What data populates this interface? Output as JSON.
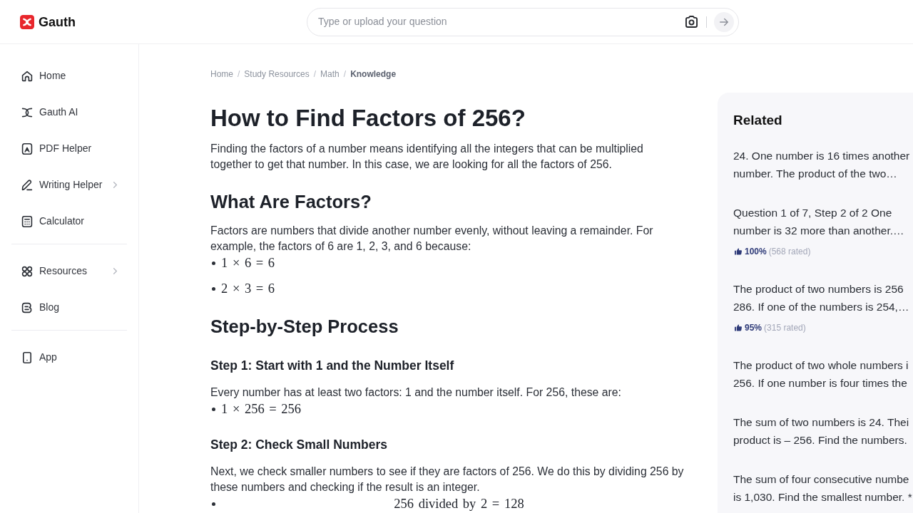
{
  "header": {
    "logo": {
      "text": "Gauth"
    },
    "search": {
      "placeholder": "Type or upload your question"
    }
  },
  "sidebar": {
    "sections": [
      {
        "items": [
          {
            "label": "Home",
            "submenu": false
          },
          {
            "label": "Gauth AI",
            "submenu": false
          },
          {
            "label": "PDF Helper",
            "submenu": false
          },
          {
            "label": "Writing Helper",
            "submenu": true
          },
          {
            "label": "Calculator",
            "submenu": false
          }
        ]
      },
      {
        "items": [
          {
            "label": "Resources",
            "submenu": true
          },
          {
            "label": "Blog",
            "submenu": false
          }
        ]
      },
      {
        "items": [
          {
            "label": "App",
            "submenu": false
          }
        ]
      }
    ]
  },
  "breadcrumb": {
    "separator": "/",
    "items": [
      {
        "label": "Home",
        "current": false
      },
      {
        "label": "Study Resources",
        "current": false
      },
      {
        "label": "Math",
        "current": false
      },
      {
        "label": "Knowledge",
        "current": true
      }
    ]
  },
  "article": {
    "title": "How to Find Factors of 256?",
    "blocks": [
      {
        "kind": "paragraph",
        "text": "Finding the factors of a number means identifying all the integers that can be multiplied together to get that number. In this case, we are looking for all the factors of 256."
      },
      {
        "kind": "heading",
        "text": "What Are Factors?"
      },
      {
        "kind": "paragraph",
        "text": "Factors are numbers that divide another number evenly, without leaving a remainder. For example, the factors of 6 are 1, 2, 3, and 6 because:"
      },
      {
        "kind": "math_list",
        "items": [
          {
            "kind": "inline",
            "text": "1 × 6 = 6"
          },
          {
            "kind": "inline",
            "text": "2 × 3 = 6"
          }
        ]
      },
      {
        "kind": "heading",
        "text": "Step-by-Step Process"
      },
      {
        "kind": "subheading",
        "text": "Step 1: Start with 1 and the Number Itself"
      },
      {
        "kind": "paragraph",
        "text": "Every number has at least two factors: 1 and the number itself. For 256, these are:"
      },
      {
        "kind": "math_list",
        "items": [
          {
            "kind": "inline",
            "text": "1 × 256 = 256"
          }
        ]
      },
      {
        "kind": "subheading",
        "text": "Step 2: Check Small Numbers"
      },
      {
        "kind": "paragraph",
        "text": "Next, we check smaller numbers to see if they are factors of 256. We do this by dividing 256 by these numbers and checking if the result is an integer."
      },
      {
        "kind": "math_list",
        "items": [
          {
            "kind": "display",
            "text": "256 divided by 2 = 128"
          }
        ]
      }
    ]
  },
  "related": {
    "title": "Related",
    "items": [
      {
        "lines": [
          "24. One number is 16 times another",
          "number. The product of the two…"
        ]
      },
      {
        "lines": [
          "Question 1 of 7, Step 2 of 2 One",
          "number is 32 more than another.…"
        ],
        "rating": {
          "percent": "100%",
          "count": "(568 rated)"
        }
      },
      {
        "lines": [
          "The product of two numbers is 256",
          "286. If one of the numbers is 254,…"
        ],
        "rating": {
          "percent": "95%",
          "count": "(315 rated)"
        }
      },
      {
        "lines": [
          "The product of two whole numbers i",
          "256. If one number is four times the"
        ]
      },
      {
        "lines": [
          "The sum of two numbers is 24. Thei",
          "product is – 256. Find the numbers."
        ]
      },
      {
        "lines": [
          "The sum of four consecutive numbe",
          "is 1,030. Find the smallest number. *"
        ]
      }
    ]
  }
}
